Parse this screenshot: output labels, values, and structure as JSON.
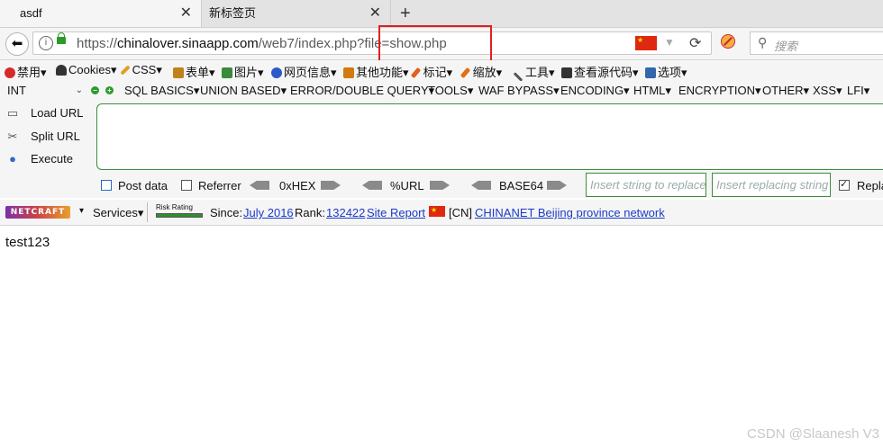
{
  "tabs": [
    {
      "title": "asdf",
      "active": true
    },
    {
      "title": "新标签页",
      "active": false
    }
  ],
  "navbar": {
    "url_prefix": "https://",
    "url_host": "chinalover.sinaapp.com",
    "url_path": "/web7/index.php?file=show.php",
    "search_placeholder": "搜索"
  },
  "menubar": [
    {
      "label": "禁用▾",
      "icon": "disable-icon",
      "color": "#d62a2a"
    },
    {
      "label": "Cookies▾",
      "icon": "user-icon",
      "color": "#333333"
    },
    {
      "label": "CSS▾",
      "icon": "pencil-icon",
      "color": "#e0a020"
    },
    {
      "label": "表单▾",
      "icon": "form-icon",
      "color": "#c0801a"
    },
    {
      "label": "图片▾",
      "icon": "image-icon",
      "color": "#3a8a3a"
    },
    {
      "label": "网页信息▾",
      "icon": "info-icon",
      "color": "#2a5ac8"
    },
    {
      "label": "其他功能▾",
      "icon": "misc-icon",
      "color": "#d07a10"
    },
    {
      "label": "标记▾",
      "icon": "highlighter-icon",
      "color": "#e06020"
    },
    {
      "label": "缩放▾",
      "icon": "resize-icon",
      "color": "#e07010"
    },
    {
      "label": "工具▾",
      "icon": "tools-icon",
      "color": "#555555"
    },
    {
      "label": "查看源代码▾",
      "icon": "source-icon",
      "color": "#333333"
    },
    {
      "label": "选项▾",
      "icon": "options-icon",
      "color": "#3366aa"
    }
  ],
  "hackbar": {
    "select_value": "INT",
    "menus": [
      "SQL BASICS▾",
      "UNION BASED▾",
      "ERROR/DOUBLE QUERY▾",
      "TOOLS▾",
      "WAF BYPASS▾",
      "ENCODING▾",
      "HTML▾",
      "ENCRYPTION▾",
      "OTHER▾",
      "XSS▾",
      "LFI▾"
    ],
    "buttons": [
      "Load URL",
      "Split URL",
      "Execute"
    ],
    "options": {
      "post_data": "Post data",
      "referrer": "Referrer",
      "hex": "0xHEX",
      "url": "%URL",
      "base64": "BASE64",
      "insert_placeholder": "Insert string to replace",
      "replacing_placeholder": "Insert replacing string",
      "replace_all": "Replace All",
      "replace_all_checked": true
    }
  },
  "netcraft": {
    "logo": "NETCRAFT",
    "services": "Services▾",
    "risk_label": "Risk Rating",
    "since_label": "Since:",
    "since_value": "July 2016",
    "rank_label": "Rank:",
    "rank_value": "132422",
    "site_report": "Site Report",
    "country": "[CN]",
    "network": "CHINANET Beijing province network"
  },
  "page": {
    "content": "test123"
  },
  "watermark": "CSDN @Slaanesh V3"
}
